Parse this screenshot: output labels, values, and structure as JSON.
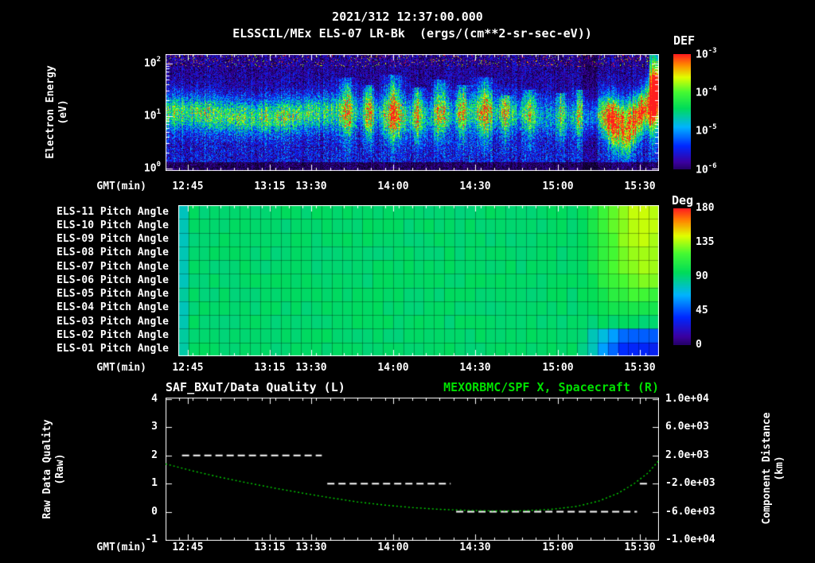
{
  "header": {
    "datetime": "2021/312 12:37:00.000",
    "title": "ELSSCIL/MEx ELS-07 LR-Bk  (ergs/(cm**2-sr-sec-eV))"
  },
  "time_axis": {
    "label": "GMT(min)",
    "start": "12:37",
    "duration_min": 180,
    "ticks": [
      {
        "label": "12:45",
        "min": 8
      },
      {
        "label": "13:15",
        "min": 38
      },
      {
        "label": "13:30",
        "min": 53
      },
      {
        "label": "14:00",
        "min": 83
      },
      {
        "label": "14:30",
        "min": 113
      },
      {
        "label": "15:00",
        "min": 143
      },
      {
        "label": "15:30",
        "min": 173
      }
    ]
  },
  "spectrogram": {
    "ylabel1": "Electron Energy",
    "ylabel2": "(eV)",
    "yticks": [
      {
        "base": "10",
        "exp": "2"
      },
      {
        "base": "10",
        "exp": "1"
      },
      {
        "base": "10",
        "exp": "0"
      }
    ],
    "colorbar": {
      "title": "DEF",
      "ticks": [
        {
          "base": "10",
          "exp": "-3"
        },
        {
          "base": "10",
          "exp": "-4"
        },
        {
          "base": "10",
          "exp": "-5"
        },
        {
          "base": "10",
          "exp": "-6"
        }
      ]
    }
  },
  "pitch": {
    "rows": [
      "ELS-11 Pitch Angle",
      "ELS-10 Pitch Angle",
      "ELS-09 Pitch Angle",
      "ELS-08 Pitch Angle",
      "ELS-07 Pitch Angle",
      "ELS-06 Pitch Angle",
      "ELS-05 Pitch Angle",
      "ELS-04 Pitch Angle",
      "ELS-03 Pitch Angle",
      "ELS-02 Pitch Angle",
      "ELS-01 Pitch Angle"
    ],
    "colorbar": {
      "title": "Deg",
      "ticks": [
        "180",
        "135",
        "90",
        "45",
        "0"
      ]
    }
  },
  "lineplot": {
    "title_left": "SAF_BXuT/Data Quality (L)",
    "title_right": "MEXORBMC/SPF X, Spacecraft (R)",
    "left_label1": "Raw Data Quality",
    "left_label2": "(Raw)",
    "right_label1": "Component Distance",
    "right_label2": "(km)",
    "left_ticks": [
      "4",
      "3",
      "2",
      "1",
      "0",
      "-1"
    ],
    "right_ticks": [
      "1.0e+04",
      "6.0e+03",
      "2.0e+03",
      "-2.0e+03",
      "-6.0e+03",
      "-1.0e+04"
    ]
  },
  "colors": {
    "background": "#000000",
    "text": "#ffffff",
    "series_right": "#00d400"
  },
  "chart_data": [
    {
      "type": "heatmap",
      "name": "electron-energy-spectrogram",
      "title": "ELSSCIL/MEx ELS-07 LR-Bk (ergs/(cm**2-sr-sec-eV))",
      "xlabel": "GMT(min)",
      "ylabel": "Electron Energy (eV)",
      "x_start": "12:37",
      "x_end": "15:37",
      "duration_min": 180,
      "y_scale": "log",
      "y_range_eV": [
        1,
        150
      ],
      "colorbar": {
        "title": "DEF",
        "units": "ergs/(cm**2-sr-sec-eV)",
        "min": 1e-06,
        "max": 0.001,
        "scale": "log"
      },
      "band": {
        "log10E_center": 1.03,
        "amp_early": 0.42,
        "amp_late": 0.24,
        "fade_start_min": 50,
        "fade_end_min": 70
      },
      "plumes": [
        {
          "t": 66,
          "w": 1.6,
          "a": 0.45,
          "top": 1.75
        },
        {
          "t": 74,
          "w": 1.2,
          "a": 0.5,
          "top": 1.6
        },
        {
          "t": 83,
          "w": 2.0,
          "a": 0.55,
          "top": 1.8
        },
        {
          "t": 92,
          "w": 1.3,
          "a": 0.45,
          "top": 1.55
        },
        {
          "t": 100,
          "w": 1.6,
          "a": 0.5,
          "top": 1.7
        },
        {
          "t": 108,
          "w": 1.4,
          "a": 0.45,
          "top": 1.6
        },
        {
          "t": 116,
          "w": 2.0,
          "a": 0.5,
          "top": 1.75
        },
        {
          "t": 124,
          "w": 1.2,
          "a": 0.35,
          "top": 1.4
        },
        {
          "t": 133,
          "w": 1.5,
          "a": 0.3,
          "top": 1.5
        },
        {
          "t": 144,
          "w": 1.2,
          "a": 0.3,
          "top": 1.45
        },
        {
          "t": 151,
          "w": 1.0,
          "a": 0.35,
          "top": 1.5
        }
      ],
      "swoosh": {
        "start_min": 157,
        "amp": 0.62
      }
    },
    {
      "type": "heatmap",
      "name": "pitch-angle-panel",
      "rows": [
        "ELS-11",
        "ELS-10",
        "ELS-09",
        "ELS-08",
        "ELS-07",
        "ELS-06",
        "ELS-05",
        "ELS-04",
        "ELS-03",
        "ELS-02",
        "ELS-01"
      ],
      "colorbar": {
        "title": "Deg",
        "min": 0,
        "max": 180
      },
      "baseline_deg": 90,
      "end_deg": [
        138,
        137,
        136,
        134,
        132,
        126,
        115,
        104,
        90,
        42,
        28
      ],
      "transition_start_min": 148,
      "transition_end_min": 172
    },
    {
      "type": "line",
      "name": "quality-and-distance",
      "xlabel": "GMT(min)",
      "left_axis": {
        "label": "Raw Data Quality (Raw)",
        "min": -1,
        "max": 4,
        "ticks": [
          4,
          3,
          2,
          1,
          0,
          -1
        ]
      },
      "right_axis": {
        "label": "Component Distance (km)",
        "min": -10000,
        "max": 10000,
        "ticks": [
          10000,
          6000,
          2000,
          -2000,
          -6000,
          -10000
        ]
      },
      "series": [
        {
          "name": "SAF_BXuT/Data Quality (L)",
          "axis": "left",
          "color": "#ffffff",
          "style": "dashed",
          "steps": [
            {
              "t1": 6,
              "t2": 57,
              "value": 2
            },
            {
              "t1": 59,
              "t2": 104,
              "value": 1
            },
            {
              "t1": 106,
              "t2": 172,
              "value": 0
            },
            {
              "t1": 173,
              "t2": 176,
              "value": 1
            }
          ]
        },
        {
          "name": "MEXORBMC/SPF X, Spacecraft (R)",
          "axis": "right",
          "color": "#00d400",
          "style": "dotted",
          "points_t_km": [
            [
              0,
              800
            ],
            [
              10,
              -200
            ],
            [
              20,
              -1100
            ],
            [
              30,
              -1900
            ],
            [
              40,
              -2650
            ],
            [
              50,
              -3350
            ],
            [
              60,
              -4000
            ],
            [
              70,
              -4600
            ],
            [
              80,
              -5050
            ],
            [
              90,
              -5400
            ],
            [
              100,
              -5650
            ],
            [
              110,
              -5800
            ],
            [
              120,
              -5880
            ],
            [
              130,
              -5860
            ],
            [
              140,
              -5680
            ],
            [
              150,
              -5230
            ],
            [
              158,
              -4480
            ],
            [
              165,
              -3380
            ],
            [
              171,
              -1980
            ],
            [
              176,
              -480
            ],
            [
              180,
              1300
            ]
          ]
        }
      ]
    }
  ]
}
